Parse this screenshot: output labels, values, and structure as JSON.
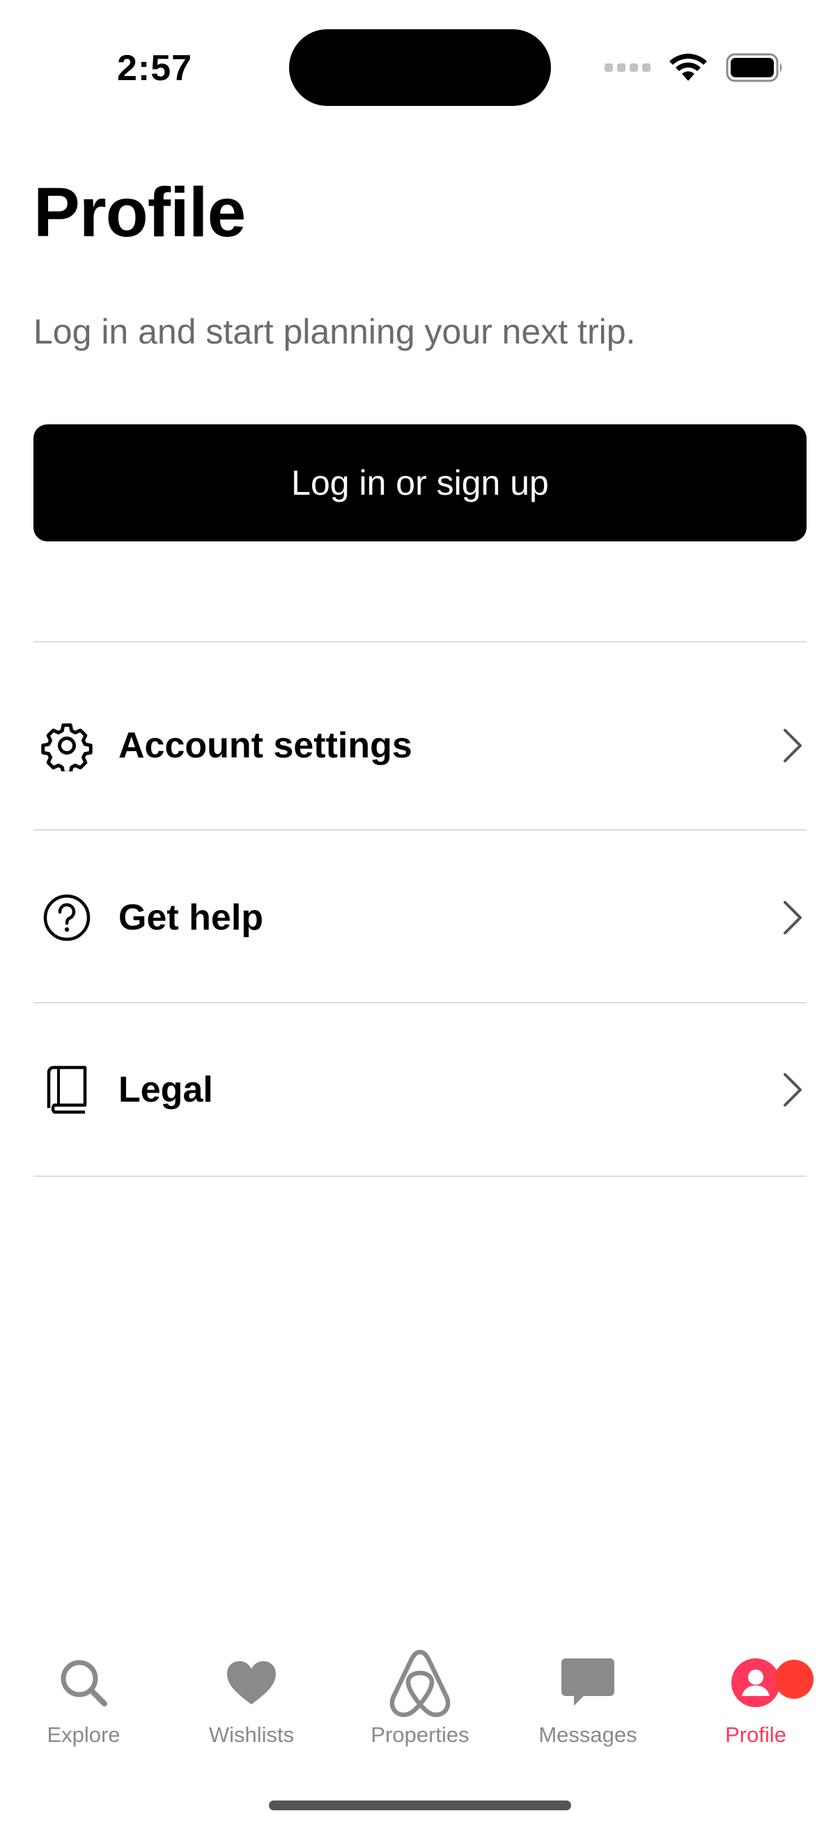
{
  "status_bar": {
    "time": "2:57",
    "icons": [
      "signal-icon",
      "wifi-icon",
      "battery-icon"
    ]
  },
  "header": {
    "title": "Profile",
    "subtitle": "Log in and start planning your next trip."
  },
  "login_button": {
    "label": "Log in or sign up"
  },
  "menu": {
    "items": [
      {
        "label": "Account settings",
        "icon": "gear-icon"
      },
      {
        "label": "Get help",
        "icon": "help-circle-icon"
      },
      {
        "label": "Legal",
        "icon": "book-icon"
      }
    ]
  },
  "tab_bar": {
    "active": "Profile",
    "active_color": "#ff385c",
    "inactive_color": "#8a8a8a",
    "tabs": [
      {
        "label": "Explore",
        "icon": "search-icon"
      },
      {
        "label": "Wishlists",
        "icon": "heart-icon"
      },
      {
        "label": "Properties",
        "icon": "airbnb-logo-icon"
      },
      {
        "label": "Messages",
        "icon": "message-icon"
      },
      {
        "label": "Profile",
        "icon": "profile-icon"
      }
    ]
  },
  "colors": {
    "badge": "#ff3b30",
    "button_bg": "#000000",
    "subtitle_text": "#6b6b6b"
  }
}
